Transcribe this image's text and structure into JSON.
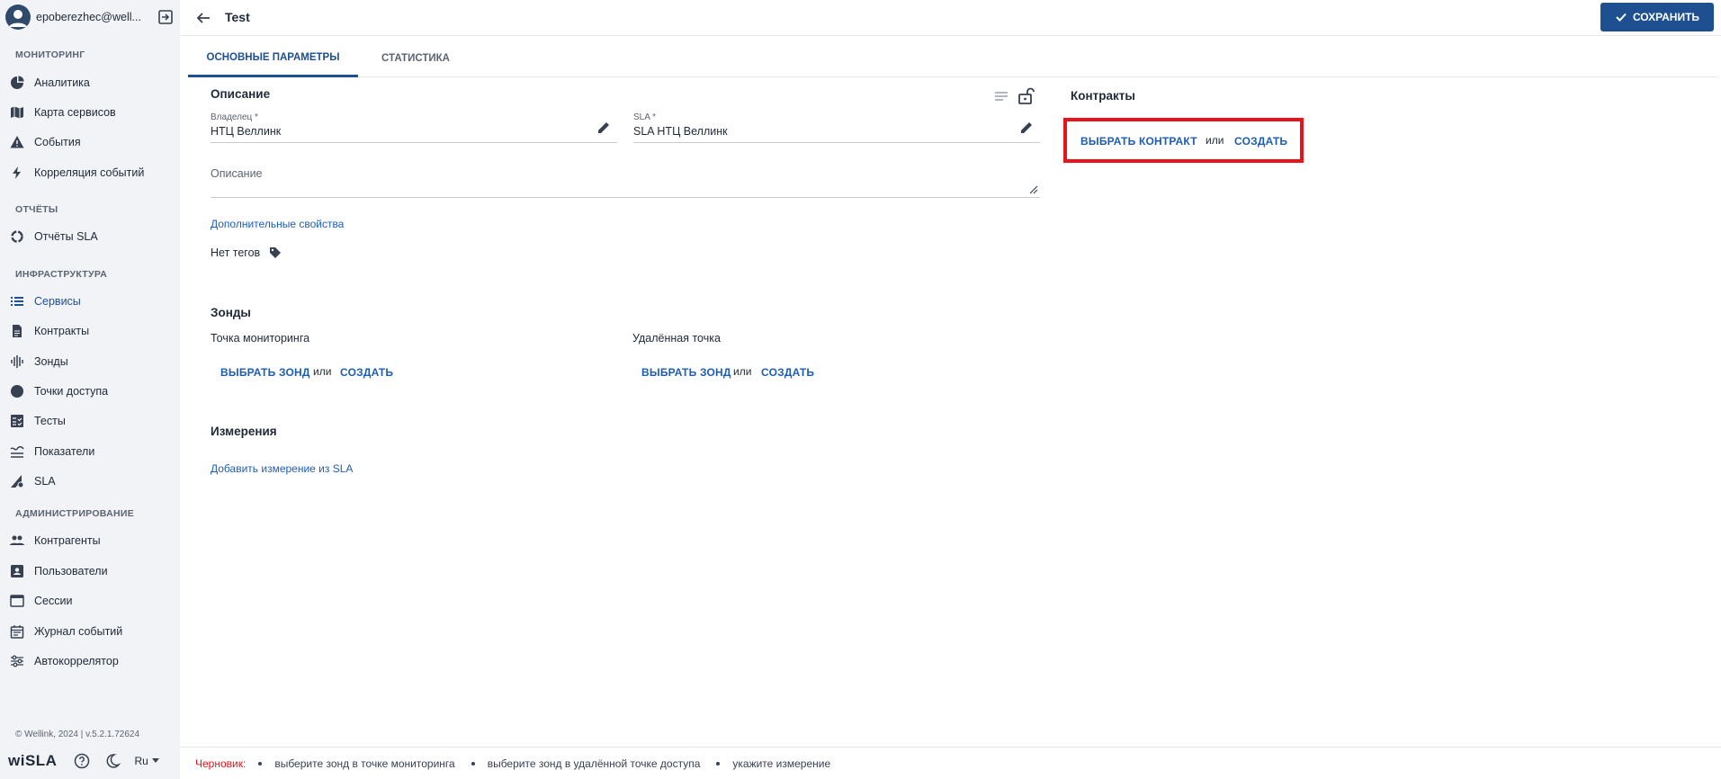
{
  "user": {
    "name": "epoberezhec@well..."
  },
  "sidebar": {
    "sections": {
      "monitoring": "МОНИТОРИНГ",
      "reports": "ОТЧЁТЫ",
      "infra": "ИНФРАСТРУКТУРА",
      "admin": "АДМИНИСТРИРОВАНИЕ"
    },
    "items": {
      "analytics": "Аналитика",
      "service_map": "Карта сервисов",
      "events": "События",
      "event_correlation": "Корреляция событий",
      "sla_reports": "Отчёты SLA",
      "services": "Сервисы",
      "contracts": "Контракты",
      "probes": "Зонды",
      "access_points": "Точки доступа",
      "tests": "Тесты",
      "metrics": "Показатели",
      "sla": "SLA",
      "counterparties": "Контрагенты",
      "users": "Пользователи",
      "sessions": "Сессии",
      "event_log": "Журнал событий",
      "autocorrelator": "Автокоррелятор"
    },
    "copyright": "© Wellink, 2024 | v.5.2.1.72624",
    "brand": "wiSLA",
    "lang": "Ru"
  },
  "header": {
    "title": "Test",
    "save_label": "СОХРАНИТЬ"
  },
  "tabs": {
    "main": "ОСНОВНЫЕ ПАРАМЕТРЫ",
    "stats": "СТАТИСТИКА"
  },
  "description": {
    "heading": "Описание",
    "owner_label": "Владелец *",
    "owner_value": "НТЦ Веллинк",
    "sla_label": "SLA *",
    "sla_value": "SLA НТЦ Веллинк",
    "desc_placeholder": "Описание",
    "extra_props": "Дополнительные свойства",
    "no_tags": "Нет тегов"
  },
  "contracts": {
    "heading": "Контракты",
    "choose": "ВЫБРАТЬ КОНТРАКТ",
    "or": "или",
    "create": "СОЗДАТЬ"
  },
  "probes": {
    "heading": "Зонды",
    "monitoring_point": "Точка мониторинга",
    "remote_point": "Удалённая точка",
    "choose": "ВЫБРАТЬ ЗОНД",
    "or": "или",
    "create": "СОЗДАТЬ"
  },
  "measurements": {
    "heading": "Измерения",
    "add_from_sla": "Добавить измерение из SLA"
  },
  "status": {
    "draft": "Черновик:",
    "items": [
      "выберите зонд в точке мониторинга",
      "выберите зонд в удалённой точке доступа",
      "укажите измерение"
    ]
  }
}
